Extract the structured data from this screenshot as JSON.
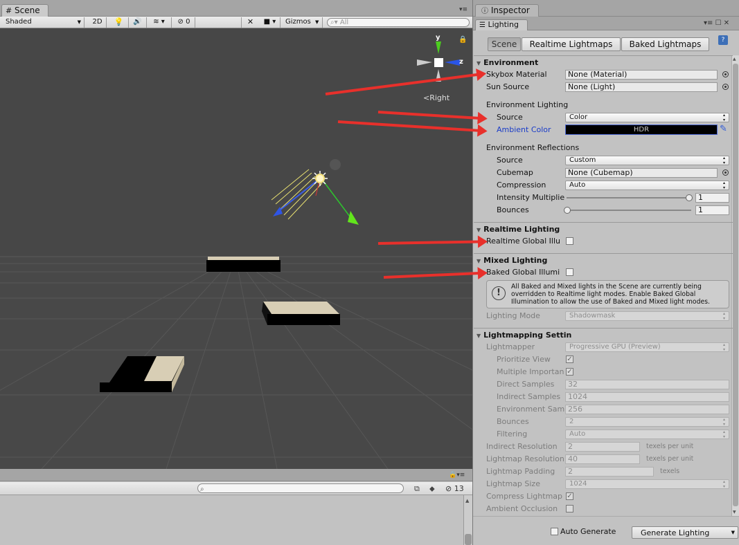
{
  "scene": {
    "tab_label": "Scene",
    "shading_mode": "Shaded",
    "btn_2d": "2D",
    "hidden_count": "0",
    "gizmos_label": "Gizmos",
    "search_placeholder": "All",
    "axis_x": "x",
    "axis_y": "y",
    "axis_z": "z",
    "view_label": "Right"
  },
  "bottom": {
    "count": "13"
  },
  "inspector": {
    "tab_label": "Inspector",
    "lighting_tab": "Lighting",
    "subtabs": [
      "Scene",
      "Realtime Lightmaps",
      "Baked Lightmaps"
    ],
    "environment": {
      "header": "Environment",
      "skybox_label": "Skybox Material",
      "skybox_value": "None (Material)",
      "sun_label": "Sun Source",
      "sun_value": "None (Light)",
      "env_lighting_header": "Environment Lighting",
      "source_label": "Source",
      "source_value": "Color",
      "ambient_label": "Ambient Color",
      "ambient_value": "HDR",
      "env_reflections_header": "Environment Reflections",
      "refl_source_label": "Source",
      "refl_source_value": "Custom",
      "cubemap_label": "Cubemap",
      "cubemap_value": "None (Cubemap)",
      "compression_label": "Compression",
      "compression_value": "Auto",
      "intensity_label": "Intensity Multiplie",
      "intensity_value": "1",
      "bounces_label": "Bounces",
      "bounces_value": "1"
    },
    "realtime": {
      "header": "Realtime Lighting",
      "gi_label": "Realtime Global Illu"
    },
    "mixed": {
      "header": "Mixed Lighting",
      "baked_gi_label": "Baked Global Illumi",
      "info_text_1": "All Baked and Mixed lights in the Scene are currently being",
      "info_text_2": "overridden to Realtime light modes. Enable Baked Global",
      "info_text_3": "Illumination to allow the use of Baked and Mixed light modes.",
      "lighting_mode_label": "Lighting Mode",
      "lighting_mode_value": "Shadowmask"
    },
    "lightmapping": {
      "header": "Lightmapping Settin",
      "lightmapper_label": "Lightmapper",
      "lightmapper_value": "Progressive GPU (Preview)",
      "prioritize_label": "Prioritize View",
      "multiple_label": "Multiple Importan",
      "direct_label": "Direct Samples",
      "direct_value": "32",
      "indirect_label": "Indirect Samples",
      "indirect_value": "1024",
      "env_samples_label": "Environment Sam",
      "env_samples_value": "256",
      "bounces_label": "Bounces",
      "bounces_value": "2",
      "filtering_label": "Filtering",
      "filtering_value": "Auto",
      "indirect_res_label": "Indirect Resolution",
      "indirect_res_value": "2",
      "texels_per_unit": "texels per unit",
      "lightmap_res_label": "Lightmap Resolution",
      "lightmap_res_value": "40",
      "padding_label": "Lightmap Padding",
      "padding_value": "2",
      "texels": "texels",
      "size_label": "Lightmap Size",
      "size_value": "1024",
      "compress_label": "Compress Lightmap",
      "ao_label": "Ambient Occlusion"
    },
    "footer": {
      "auto_generate": "Auto Generate",
      "generate_button": "Generate Lighting"
    }
  },
  "colors": {
    "arrow": "#e8302b",
    "ambient_label": "#1a3cc8",
    "viewport": "#474747"
  }
}
